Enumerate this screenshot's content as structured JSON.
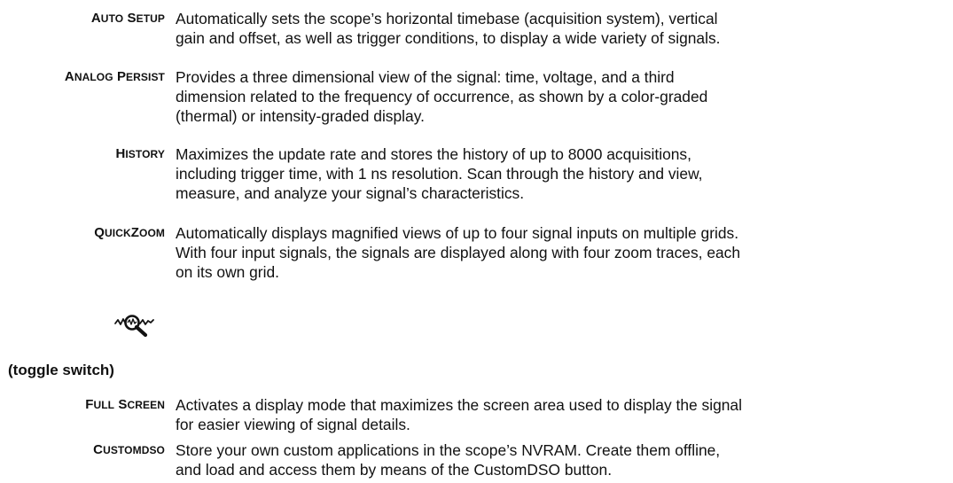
{
  "entries": [
    {
      "term_parts": [
        {
          "cap": "A",
          "sc": "UTO"
        },
        {
          "cap": " S",
          "sc": "ETUP"
        }
      ],
      "description": "Automatically sets the scope’s horizontal timebase (acquisition system), vertical\ngain and offset, as well as trigger conditions, to display a wide variety of signals."
    },
    {
      "term_parts": [
        {
          "cap": "A",
          "sc": "NALOG"
        },
        {
          "cap": " P",
          "sc": "ERSIST"
        }
      ],
      "description": "Provides a three dimensional view of the signal: time, voltage, and a third\ndimension related to the frequency of occurrence, as shown by a color-graded\n(thermal) or intensity-graded display."
    },
    {
      "term_parts": [
        {
          "cap": "H",
          "sc": "ISTORY"
        }
      ],
      "description": "Maximizes the update rate and stores the history of up to 8000 acquisitions,\nincluding trigger time, with 1 ns resolution. Scan through the history and view,\nmeasure, and analyze your signal’s characteristics."
    },
    {
      "term_parts": [
        {
          "cap": "Q",
          "sc": "UICK"
        },
        {
          "cap": "Z",
          "sc": "OOM"
        }
      ],
      "description": "Automatically displays magnified views of up to four signal inputs on multiple grids.\nWith four input signals, the signals are displayed along with four zoom traces, each\non its own grid.",
      "icon": "quickzoom-magnifier-icon"
    },
    {
      "term_parts": [
        {
          "cap": "F",
          "sc": "ULL"
        },
        {
          "cap": " S",
          "sc": "CREEN"
        }
      ],
      "description": "Activates a display mode that maximizes the screen area used to display the signal\nfor easier viewing of signal details."
    },
    {
      "term_parts": [
        {
          "cap": "C",
          "sc": "USTOM"
        },
        {
          "cap": "DSO",
          "sc": ""
        }
      ],
      "description": "Store your own custom applications in the scope’s NVRAM. Create them offline,\nand load and access them by means of the CustomDSO button."
    }
  ],
  "toggle_label": "(toggle switch)"
}
